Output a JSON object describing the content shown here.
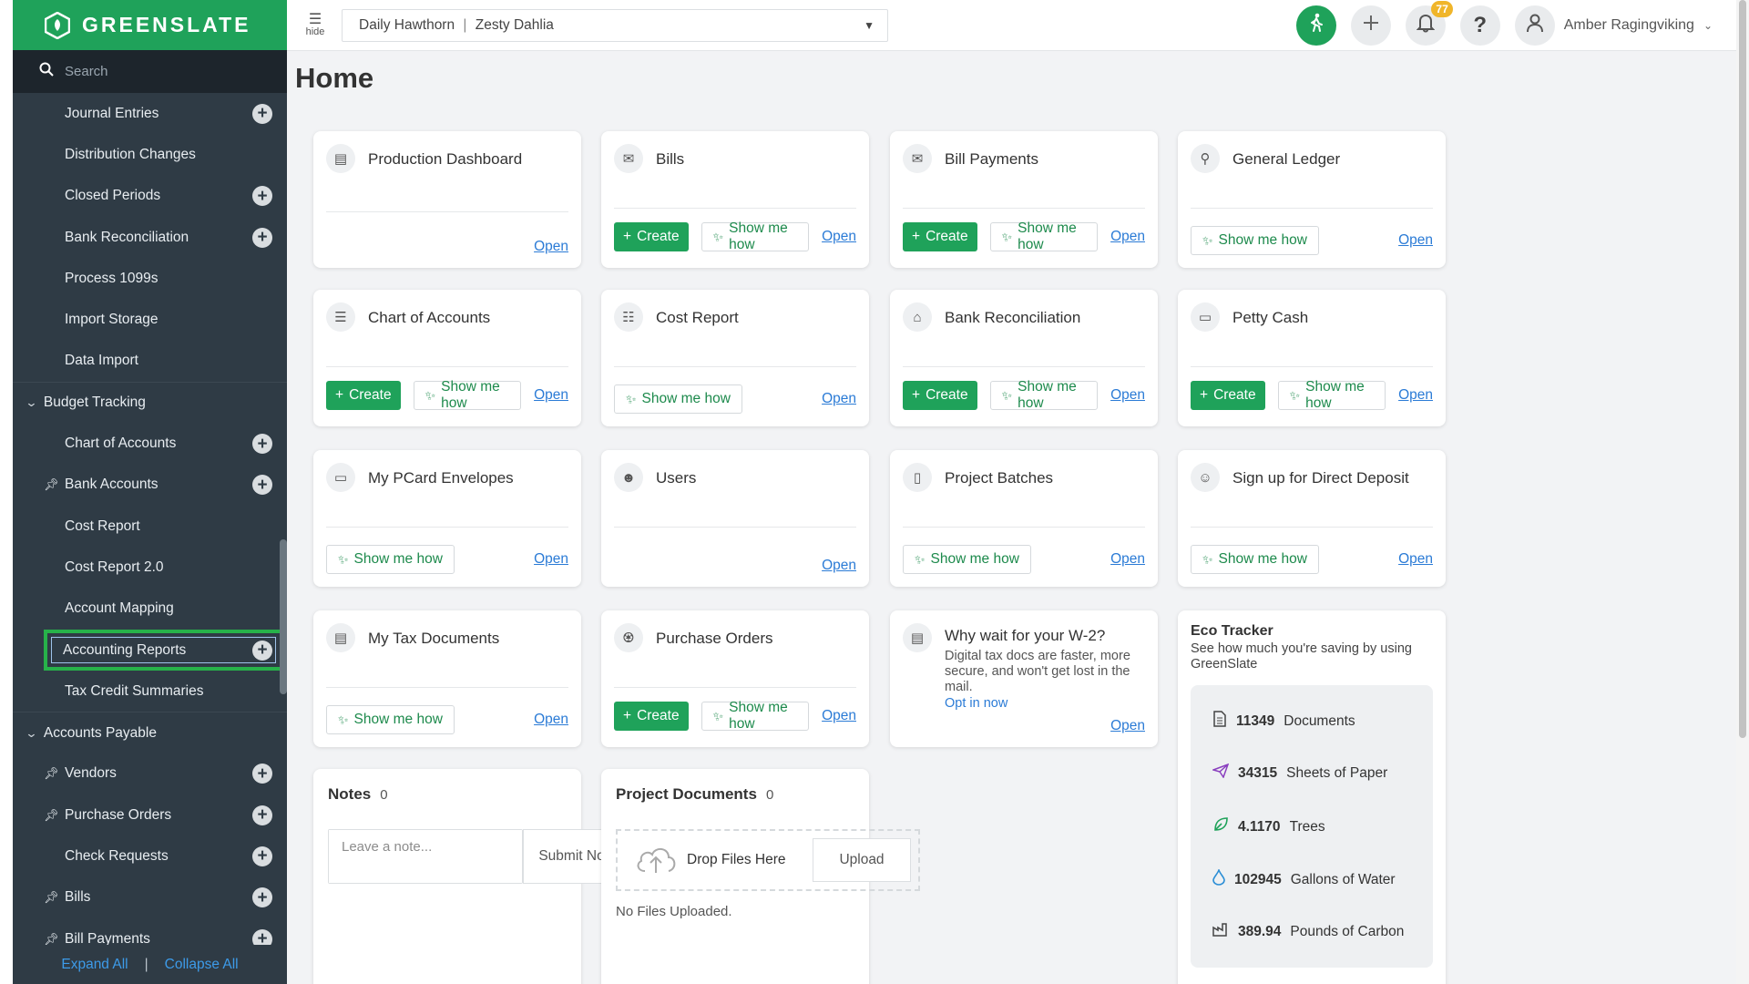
{
  "brand": {
    "name": "GREENSLATE"
  },
  "search": {
    "placeholder": "Search"
  },
  "sidebar": {
    "items": [
      {
        "label": "Journal Entries",
        "plus": true,
        "pin": false
      },
      {
        "label": "Distribution Changes",
        "plus": false,
        "pin": false
      },
      {
        "label": "Closed Periods",
        "plus": true,
        "pin": false
      },
      {
        "label": "Bank Reconciliation",
        "plus": true,
        "pin": false
      },
      {
        "label": "Process 1099s",
        "plus": false,
        "pin": false
      },
      {
        "label": "Import Storage",
        "plus": false,
        "pin": false
      },
      {
        "label": "Data Import",
        "plus": false,
        "pin": false
      }
    ],
    "section_budget": "Budget Tracking",
    "budget_items": [
      {
        "label": "Chart of Accounts",
        "plus": true,
        "pin": false
      },
      {
        "label": "Bank Accounts",
        "plus": true,
        "pin": true
      },
      {
        "label": "Cost Report",
        "plus": false,
        "pin": false
      },
      {
        "label": "Cost Report 2.0",
        "plus": false,
        "pin": false
      },
      {
        "label": "Account Mapping",
        "plus": false,
        "pin": false
      },
      {
        "label": "Accounting Reports",
        "plus": true,
        "pin": false,
        "active": true
      },
      {
        "label": "Tax Credit Summaries",
        "plus": false,
        "pin": false
      }
    ],
    "section_payable": "Accounts Payable",
    "payable_items": [
      {
        "label": "Vendors",
        "plus": true,
        "pin": true
      },
      {
        "label": "Purchase Orders",
        "plus": true,
        "pin": true
      },
      {
        "label": "Check Requests",
        "plus": true,
        "pin": false
      },
      {
        "label": "Bills",
        "plus": true,
        "pin": true
      },
      {
        "label": "Bill Payments",
        "plus": true,
        "pin": true
      }
    ],
    "expand_all": "Expand All",
    "separator": "|",
    "collapse_all": "Collapse All"
  },
  "topbar": {
    "hide_label": "hide",
    "company": "Daily Hawthorn",
    "company_sep": "|",
    "project": "Zesty Dahlia",
    "notification_count": "77",
    "help": "?",
    "user_name": "Amber Ragingviking"
  },
  "main": {
    "title": "Home",
    "create_label": "Create",
    "show_label": "Show me how",
    "open_label": "Open",
    "cards": {
      "production_dashboard": "Production Dashboard",
      "bills": "Bills",
      "bill_payments": "Bill Payments",
      "general_ledger": "General Ledger",
      "chart_of_accounts": "Chart of Accounts",
      "cost_report": "Cost Report",
      "bank_reconciliation": "Bank Reconciliation",
      "petty_cash": "Petty Cash",
      "my_pcard": "My PCard Envelopes",
      "users": "Users",
      "project_batches": "Project Batches",
      "direct_deposit": "Sign up for Direct Deposit",
      "tax_docs": "My Tax Documents",
      "purchase_orders": "Purchase Orders"
    },
    "w2": {
      "title": "Why wait for your W-2?",
      "body": "Digital tax docs are faster, more secure, and won't get lost in the mail.",
      "link": "Opt in now"
    },
    "notes": {
      "title": "Notes",
      "count": "0",
      "placeholder": "Leave a note...",
      "submit": "Submit Note"
    },
    "project_documents": {
      "title": "Project Documents",
      "count": "0",
      "drop": "Drop Files Here",
      "upload": "Upload",
      "empty": "No Files Uploaded."
    },
    "eco": {
      "title": "Eco Tracker",
      "subtitle": "See how much you're saving by using GreenSlate",
      "rows": [
        {
          "value": "11349",
          "label": "Documents",
          "icon": "document-icon"
        },
        {
          "value": "34315",
          "label": "Sheets of Paper",
          "icon": "paper-plane-icon"
        },
        {
          "value": "4.1170",
          "label": "Trees",
          "icon": "leaf-icon"
        },
        {
          "value": "102945",
          "label": "Gallons of Water",
          "icon": "water-drop-icon"
        },
        {
          "value": "389.94",
          "label": "Pounds of Carbon",
          "icon": "factory-icon"
        }
      ]
    }
  },
  "colors": {
    "brand_green": "#1fa25a",
    "sidebar_bg": "#2f3b45",
    "link_blue": "#2b7bd6",
    "badge_orange": "#f0b52a",
    "highlight_green": "#27b24a"
  }
}
